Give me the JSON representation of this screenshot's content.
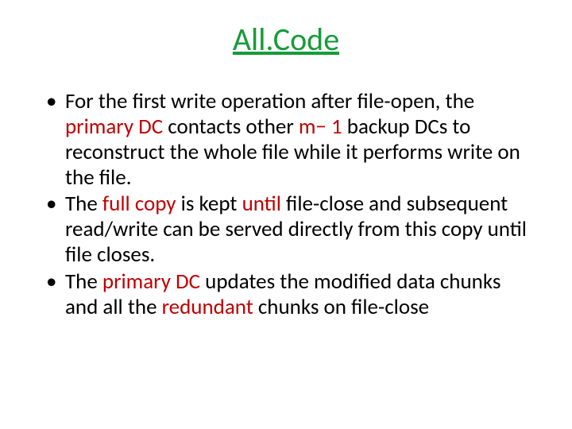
{
  "title": "All.Code",
  "b1": {
    "t1": "For the",
    "t2": " first write operation after file-open, the ",
    "r1": "primary DC",
    "t3": " contacts",
    "t4": " other ",
    "r2": "m− 1 ",
    "t5": "backup DCs to reconstruct the whole file while it",
    "t6": " performs write on the file."
  },
  "b2": {
    "t1": "The ",
    "r1": "full copy",
    "t2": " is kept ",
    "r2": "until ",
    "t3": "file-close",
    "t4": " and subsequent read/write can be served directly from this",
    "t5": " copy until file closes."
  },
  "b3": {
    "t1": "The ",
    "r1": "primary DC",
    "t2": " updates the modified",
    "t3": " data chunks and all the ",
    "r2": "redundant",
    "t4": " chunks on file-close"
  }
}
